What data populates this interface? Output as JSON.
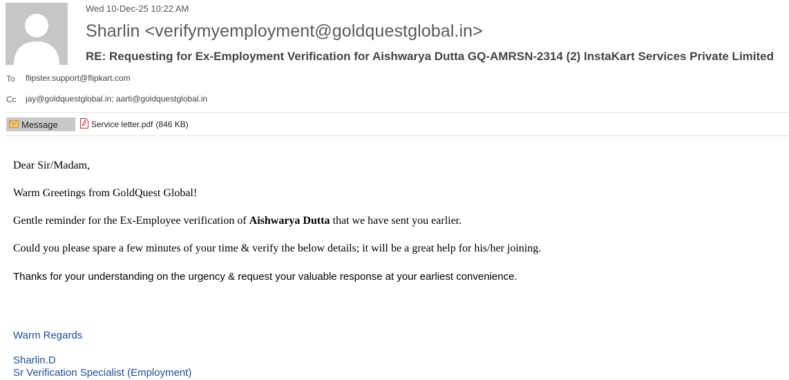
{
  "header": {
    "date": "Wed 10-Dec-25 10:22 AM",
    "sender": "Sharlin <verifymyemployment@goldquestglobal.in>",
    "subject": "RE: Requesting for Ex-Employment Verification for Aishwarya Dutta GQ-AMRSN-2314 (2) InstaKart Services Private Limited",
    "to_label": "To",
    "to_value": "flipster.support@flipkart.com",
    "cc_label": "Cc",
    "cc_value": "jay@goldquestglobal.in; aarti@goldquestglobal.in"
  },
  "tabs": {
    "message_label": "Message",
    "attachment_name": "Service letter.pdf",
    "attachment_size": "(846 KB)"
  },
  "body": {
    "salutation": "Dear Sir/Madam,",
    "greeting": "Warm Greetings from GoldQuest Global!",
    "reminder_pre": "Gentle reminder for the Ex-Employee verification of ",
    "reminder_name": "Aishwarya Dutta",
    "reminder_post": " that we have sent you earlier.",
    "request": "Could you please spare a few minutes of your time & verify the below details; it will be a great help for his/her joining.",
    "thanks": "Thanks for your understanding on the urgency & request your valuable response at your earliest convenience."
  },
  "signature": {
    "closing": "Warm Regards",
    "name": "Sharlin.D",
    "title": "Sr Verification Specialist (Employment)"
  },
  "icons": {
    "avatar": "person-silhouette-icon",
    "message_tab": "envelope-icon",
    "attachment": "pdf-file-icon"
  }
}
